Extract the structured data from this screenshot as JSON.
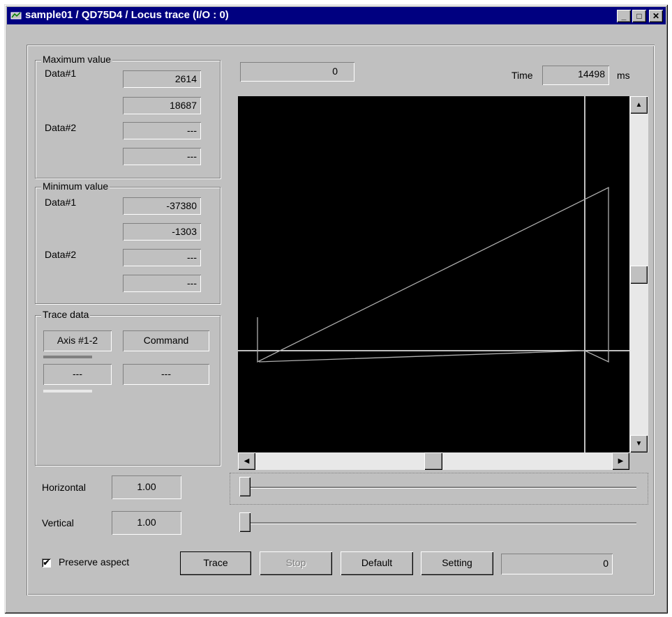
{
  "window": {
    "title": "sample01 / QD75D4 / Locus trace (I/O : 0)",
    "buttons": {
      "minimize": "_",
      "maximize": "□",
      "close": "✕"
    }
  },
  "max_group": {
    "label": "Maximum value",
    "data1_label": "Data#1",
    "data1_values": [
      "2614",
      "18687"
    ],
    "data2_label": "Data#2",
    "data2_values": [
      "---",
      "---"
    ]
  },
  "min_group": {
    "label": "Minimum value",
    "data1_label": "Data#1",
    "data1_values": [
      "-37380",
      "-1303"
    ],
    "data2_label": "Data#2",
    "data2_values": [
      "---",
      "---"
    ]
  },
  "trace_group": {
    "label": "Trace data",
    "row1": {
      "axis": "Axis #1-2",
      "type": "Command",
      "line_color": "#808080"
    },
    "row2": {
      "axis": "---",
      "type": "---",
      "line_color": "#e8e8e8"
    }
  },
  "top": {
    "position_value": "0",
    "time_label": "Time",
    "time_value": "14498",
    "time_unit": "ms"
  },
  "scale": {
    "horizontal_label": "Horizontal",
    "horizontal_value": "1.00",
    "vertical_label": "Vertical",
    "vertical_value": "1.00"
  },
  "controls": {
    "preserve_aspect_label": "Preserve aspect",
    "preserve_aspect_checked": true,
    "check_mark": "✔",
    "trace_button": "Trace",
    "stop_button": "Stop",
    "default_button": "Default",
    "setting_button": "Setting",
    "counter_value": "0"
  },
  "plot": {
    "background": "#000000",
    "trace_color": "#b0b0b0",
    "axis_color": "#ffffff"
  },
  "icons": {
    "app": "app-icon",
    "scroll_up": "▲",
    "scroll_down": "▼",
    "scroll_left": "◀",
    "scroll_right": "▶"
  }
}
